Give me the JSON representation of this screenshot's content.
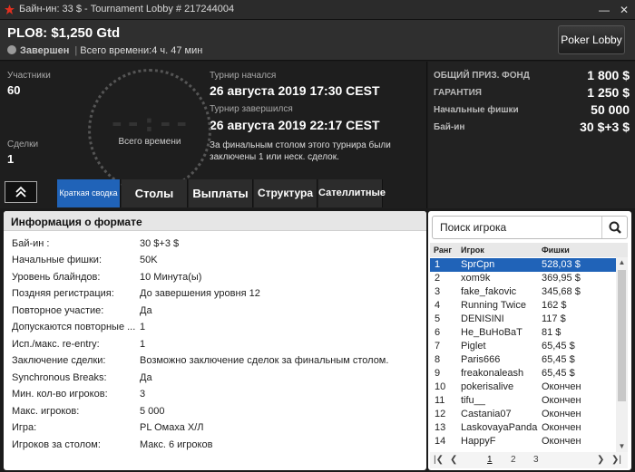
{
  "window": {
    "title": "Байн-ин: 33 $ - Tournament Lobby # 217244004"
  },
  "header": {
    "tournament_name": "PLO8: $1,250 Gtd",
    "status": "Завершен",
    "separator": "|",
    "total_time": "Всего времени:4 ч. 47 мин",
    "lobby_button": "Poker Lobby"
  },
  "stats": {
    "entrants_label": "Участники",
    "entrants_value": "60",
    "deals_label": "Сделки",
    "deals_value": "1",
    "clock_digits": "--:--",
    "clock_label": "Всего времени",
    "started_label": "Турнир начался",
    "started_value": "26 августа 2019  17:30 CEST",
    "finished_label": "Турнир завершился",
    "finished_value": "26 августа 2019  22:17 CEST",
    "deal_note": "За финальным столом этого турнира были заключены 1 или неск. сделок."
  },
  "prize": [
    {
      "label": "ОБЩИЙ ПРИЗ. ФОНД",
      "value": "1 800 $"
    },
    {
      "label": "ГАРАНТИЯ",
      "value": "1 250 $"
    },
    {
      "label": "Начальные фишки",
      "value": "50 000"
    },
    {
      "label": "Бай-ин",
      "value": "30 $+3 $"
    }
  ],
  "tabs": [
    {
      "label": "Краткая сводка"
    },
    {
      "label": "Столы"
    },
    {
      "label": "Выплаты"
    },
    {
      "label": "Структура"
    },
    {
      "label": "Сателлитные"
    }
  ],
  "info": {
    "title": "Информация о формате",
    "rows": [
      {
        "k": "Бай-ин :",
        "v": "30 $+3 $"
      },
      {
        "k": "Начальные фишки:",
        "v": "50K"
      },
      {
        "k": "Уровень блайндов:",
        "v": "10 Минута(ы)"
      },
      {
        "k": "Поздняя регистрация:",
        "v": "До завершения уровня 12"
      },
      {
        "k": "Повторное участие:",
        "v": "Да"
      },
      {
        "k": "Допускаются повторные ...",
        "v": "1"
      },
      {
        "k": "Исп./макс. re-entry:",
        "v": "1"
      },
      {
        "k": "Заключение сделки:",
        "v": "Возможно заключение сделок за финальным столом."
      },
      {
        "k": "Synchronous Breaks:",
        "v": "Да"
      },
      {
        "k": "Мин. кол-во игроков:",
        "v": "3"
      },
      {
        "k": "Макс. игроков:",
        "v": "5 000"
      },
      {
        "k": "Игра:",
        "v": "PL Омаха Х/Л"
      },
      {
        "k": "Игроков за столом:",
        "v": "Макс. 6 игроков"
      }
    ]
  },
  "players": {
    "search_placeholder": "Поиск игрока",
    "col_rank": "Ранг",
    "col_player": "Игрок",
    "col_chips": "Фишки",
    "rows": [
      {
        "rank": "1",
        "name": "SprCpn",
        "chips": "528,03 $"
      },
      {
        "rank": "2",
        "name": "xom9k",
        "chips": "369,95 $"
      },
      {
        "rank": "3",
        "name": "fake_fakovic",
        "chips": "345,68 $"
      },
      {
        "rank": "4",
        "name": "Running Twice",
        "chips": "162 $"
      },
      {
        "rank": "5",
        "name": "DENISINI",
        "chips": "117 $"
      },
      {
        "rank": "6",
        "name": "He_BuHoBaT",
        "chips": "81 $"
      },
      {
        "rank": "7",
        "name": "Piglet",
        "chips": "65,45 $"
      },
      {
        "rank": "8",
        "name": "Paris666",
        "chips": "65,45 $"
      },
      {
        "rank": "9",
        "name": "freakonaleash",
        "chips": "65,45 $"
      },
      {
        "rank": "10",
        "name": "pokerisalive",
        "chips": "Окончен"
      },
      {
        "rank": "11",
        "name": "tifu__",
        "chips": "Окончен"
      },
      {
        "rank": "12",
        "name": "Castania07",
        "chips": "Окончен"
      },
      {
        "rank": "13",
        "name": "LaskovayaPanda",
        "chips": "Окончен"
      },
      {
        "rank": "14",
        "name": "HappyF",
        "chips": "Окончен"
      }
    ],
    "pages": [
      "1",
      "2",
      "3"
    ]
  }
}
